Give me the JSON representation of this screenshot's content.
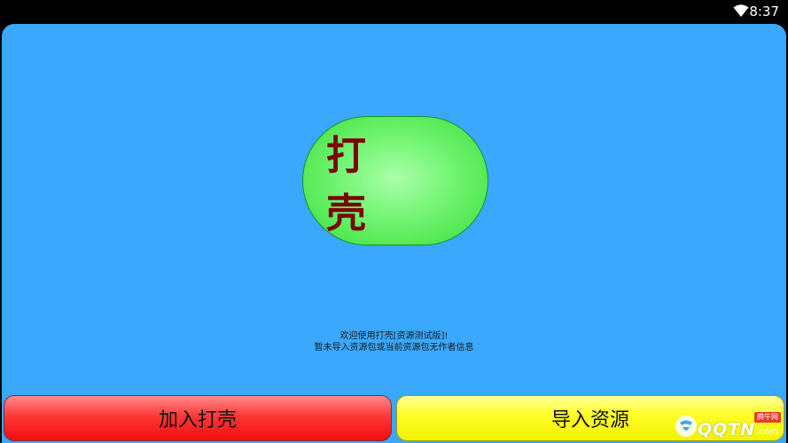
{
  "status_bar": {
    "time": "8:37",
    "wifi_icon": "wifi-icon"
  },
  "app": {
    "background_color": "#3aa8fc",
    "shell_button": {
      "label": "打 壳",
      "color": "#7df77d",
      "text_color": "#7a0000"
    },
    "info_lines": [
      "欢迎使用打壳[资源测试版]!",
      "暂未导入资源包或当前资源包无作者信息"
    ],
    "bottom_buttons": {
      "join_label": "加入打壳",
      "join_color": "#ff3838",
      "import_label": "导入资源",
      "import_color": "#ffff2a"
    }
  },
  "watermark": {
    "text": "QQTN",
    "suffix": ".com",
    "badge": "腾牛网",
    "logo_icon": "bull-logo-icon"
  }
}
